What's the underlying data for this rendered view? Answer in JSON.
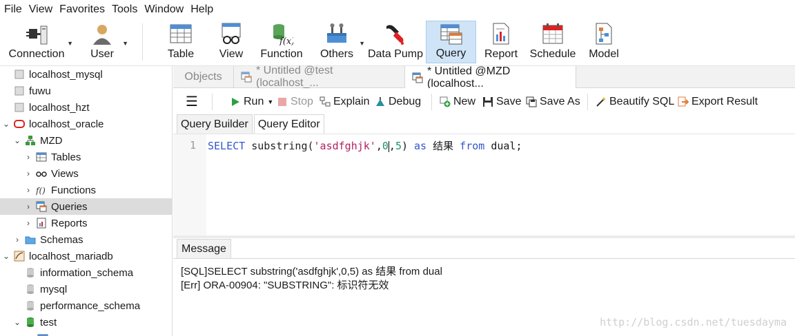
{
  "menu": [
    "File",
    "View",
    "Favorites",
    "Tools",
    "Window",
    "Help"
  ],
  "toolbar": {
    "connection": "Connection",
    "user": "User",
    "table": "Table",
    "view": "View",
    "function": "Function",
    "others": "Others",
    "data_pump": "Data Pump",
    "query": "Query",
    "report": "Report",
    "schedule": "Schedule",
    "model": "Model"
  },
  "tree": [
    {
      "label": "localhost_mysql"
    },
    {
      "label": "fuwu"
    },
    {
      "label": "localhost_hzt"
    },
    {
      "label": "localhost_oracle"
    },
    {
      "label": "MZD"
    },
    {
      "label": "Tables"
    },
    {
      "label": "Views"
    },
    {
      "label": "Functions"
    },
    {
      "label": "Queries"
    },
    {
      "label": "Reports"
    },
    {
      "label": "Schemas"
    },
    {
      "label": "localhost_mariadb"
    },
    {
      "label": "information_schema"
    },
    {
      "label": "mysql"
    },
    {
      "label": "performance_schema"
    },
    {
      "label": "test"
    }
  ],
  "tabs": {
    "objects": "Objects",
    "untitled_test": "* Untitled @test (localhost_...",
    "untitled_mzd": "* Untitled @MZD (localhost..."
  },
  "query_toolbar": {
    "run": "Run",
    "stop": "Stop",
    "explain": "Explain",
    "debug": "Debug",
    "new": "New",
    "save": "Save",
    "save_as": "Save As",
    "beautify": "Beautify SQL",
    "export": "Export Result"
  },
  "subtabs": {
    "builder": "Query Builder",
    "editor": "Query Editor"
  },
  "editor": {
    "line_number": "1",
    "kw_select": "SELECT",
    "fn_substring": "substring(",
    "str_arg": "'asdfghjk'",
    "comma1": ",",
    "num0": "0",
    "comma2": ",",
    "num5": "5",
    "close_paren": ")",
    "kw_as": "as",
    "alias": "结果",
    "kw_from": "from",
    "table": "dual;"
  },
  "message": {
    "tab": "Message",
    "line1": "[SQL]SELECT substring('asdfghjk',0,5) as 结果 from dual",
    "line2": "[Err] ORA-00904: \"SUBSTRING\": 标识符无效"
  },
  "watermark": "http://blog.csdn.net/tuesdayma",
  "colors": {
    "active_tool": "#cfe4f7",
    "keyword": "#3355cc",
    "string": "#b02060",
    "number": "#1f8f6a",
    "selected_row": "#dcdcdc"
  }
}
